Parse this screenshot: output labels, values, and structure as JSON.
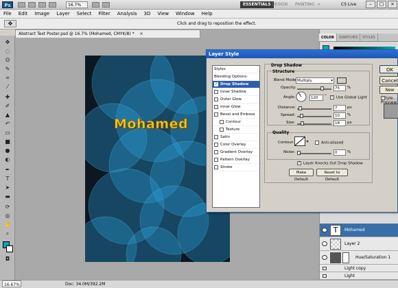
{
  "app": {
    "logo": "Ps",
    "zoom": "16.7%",
    "workspaces": [
      "ESSENTIALS",
      "DESIGN",
      "PAINTING",
      "»"
    ],
    "cs_live": "CS Live"
  },
  "menu": [
    "File",
    "Edit",
    "Image",
    "Layer",
    "Select",
    "Filter",
    "Analysis",
    "3D",
    "View",
    "Window",
    "Help"
  ],
  "options_bar": {
    "hint": "Click and drag to reposition the effect."
  },
  "document": {
    "tab_title": "Abstract Text Poster.psd @ 16.7% (Mohamed, CMYK/8) *",
    "tab_close": "×",
    "text": "Mohamed"
  },
  "status": {
    "zoom": "16.67%",
    "doc": "Doc: 34.0M/392.2M"
  },
  "panel_tabs": [
    "COLOR",
    "SWATCHES",
    "STYLES"
  ],
  "layers": [
    {
      "name": "Mohamed",
      "thumb": "T",
      "selected": true
    },
    {
      "name": "Layer 2",
      "thumb": "",
      "selected": false
    },
    {
      "name": "Hue/Saturation 1",
      "thumb": "",
      "selected": false
    },
    {
      "name": "Light copy",
      "thumb": "",
      "selected": false
    },
    {
      "name": "Light",
      "thumb": "",
      "selected": false
    }
  ],
  "dialog": {
    "title": "Layer Style",
    "styles_header": "Styles",
    "blending_options": "Blending Options: Default",
    "effects": [
      {
        "label": "Drop Shadow",
        "checked": true,
        "selected": true
      },
      {
        "label": "Inner Shadow",
        "checked": false
      },
      {
        "label": "Outer Glow",
        "checked": false
      },
      {
        "label": "Inner Glow",
        "checked": false
      },
      {
        "label": "Bevel and Emboss",
        "checked": false
      },
      {
        "label": "Contour",
        "checked": false,
        "sub": true
      },
      {
        "label": "Texture",
        "checked": false,
        "sub": true
      },
      {
        "label": "Satin",
        "checked": false
      },
      {
        "label": "Color Overlay",
        "checked": false
      },
      {
        "label": "Gradient Overlay",
        "checked": false
      },
      {
        "label": "Pattern Overlay",
        "checked": false
      },
      {
        "label": "Stroke",
        "checked": false
      }
    ],
    "drop_shadow": {
      "title": "Drop Shadow",
      "structure": "Structure",
      "blend_mode_label": "Blend Mode:",
      "blend_mode": "Multiply",
      "opacity_label": "Opacity:",
      "opacity": "75",
      "angle_label": "Angle:",
      "angle": "120",
      "degree": "°",
      "use_global_light": "Use Global Light",
      "distance_label": "Distance:",
      "distance": "7",
      "spread_label": "Spread:",
      "spread": "10",
      "size_label": "Size:",
      "size": "18",
      "px": "px",
      "pct": "%",
      "quality": "Quality",
      "contour_label": "Contour:",
      "anti_aliased": "Anti-aliased",
      "noise_label": "Noise:",
      "noise": "0",
      "knocks_out": "Layer Knocks Out Drop Shadow",
      "make_default": "Make Default",
      "reset_default": "Reset to Default"
    },
    "buttons": {
      "ok": "OK",
      "cancel": "Cancel",
      "new_style": "New Style...",
      "preview": "Preview"
    },
    "opacity_fraction": 0.75,
    "noise_fraction": 0.0
  },
  "colors": {
    "accent": "#2d5ea8",
    "shadow_color": "#1a1a1a",
    "text_fill": "#f0c419"
  }
}
